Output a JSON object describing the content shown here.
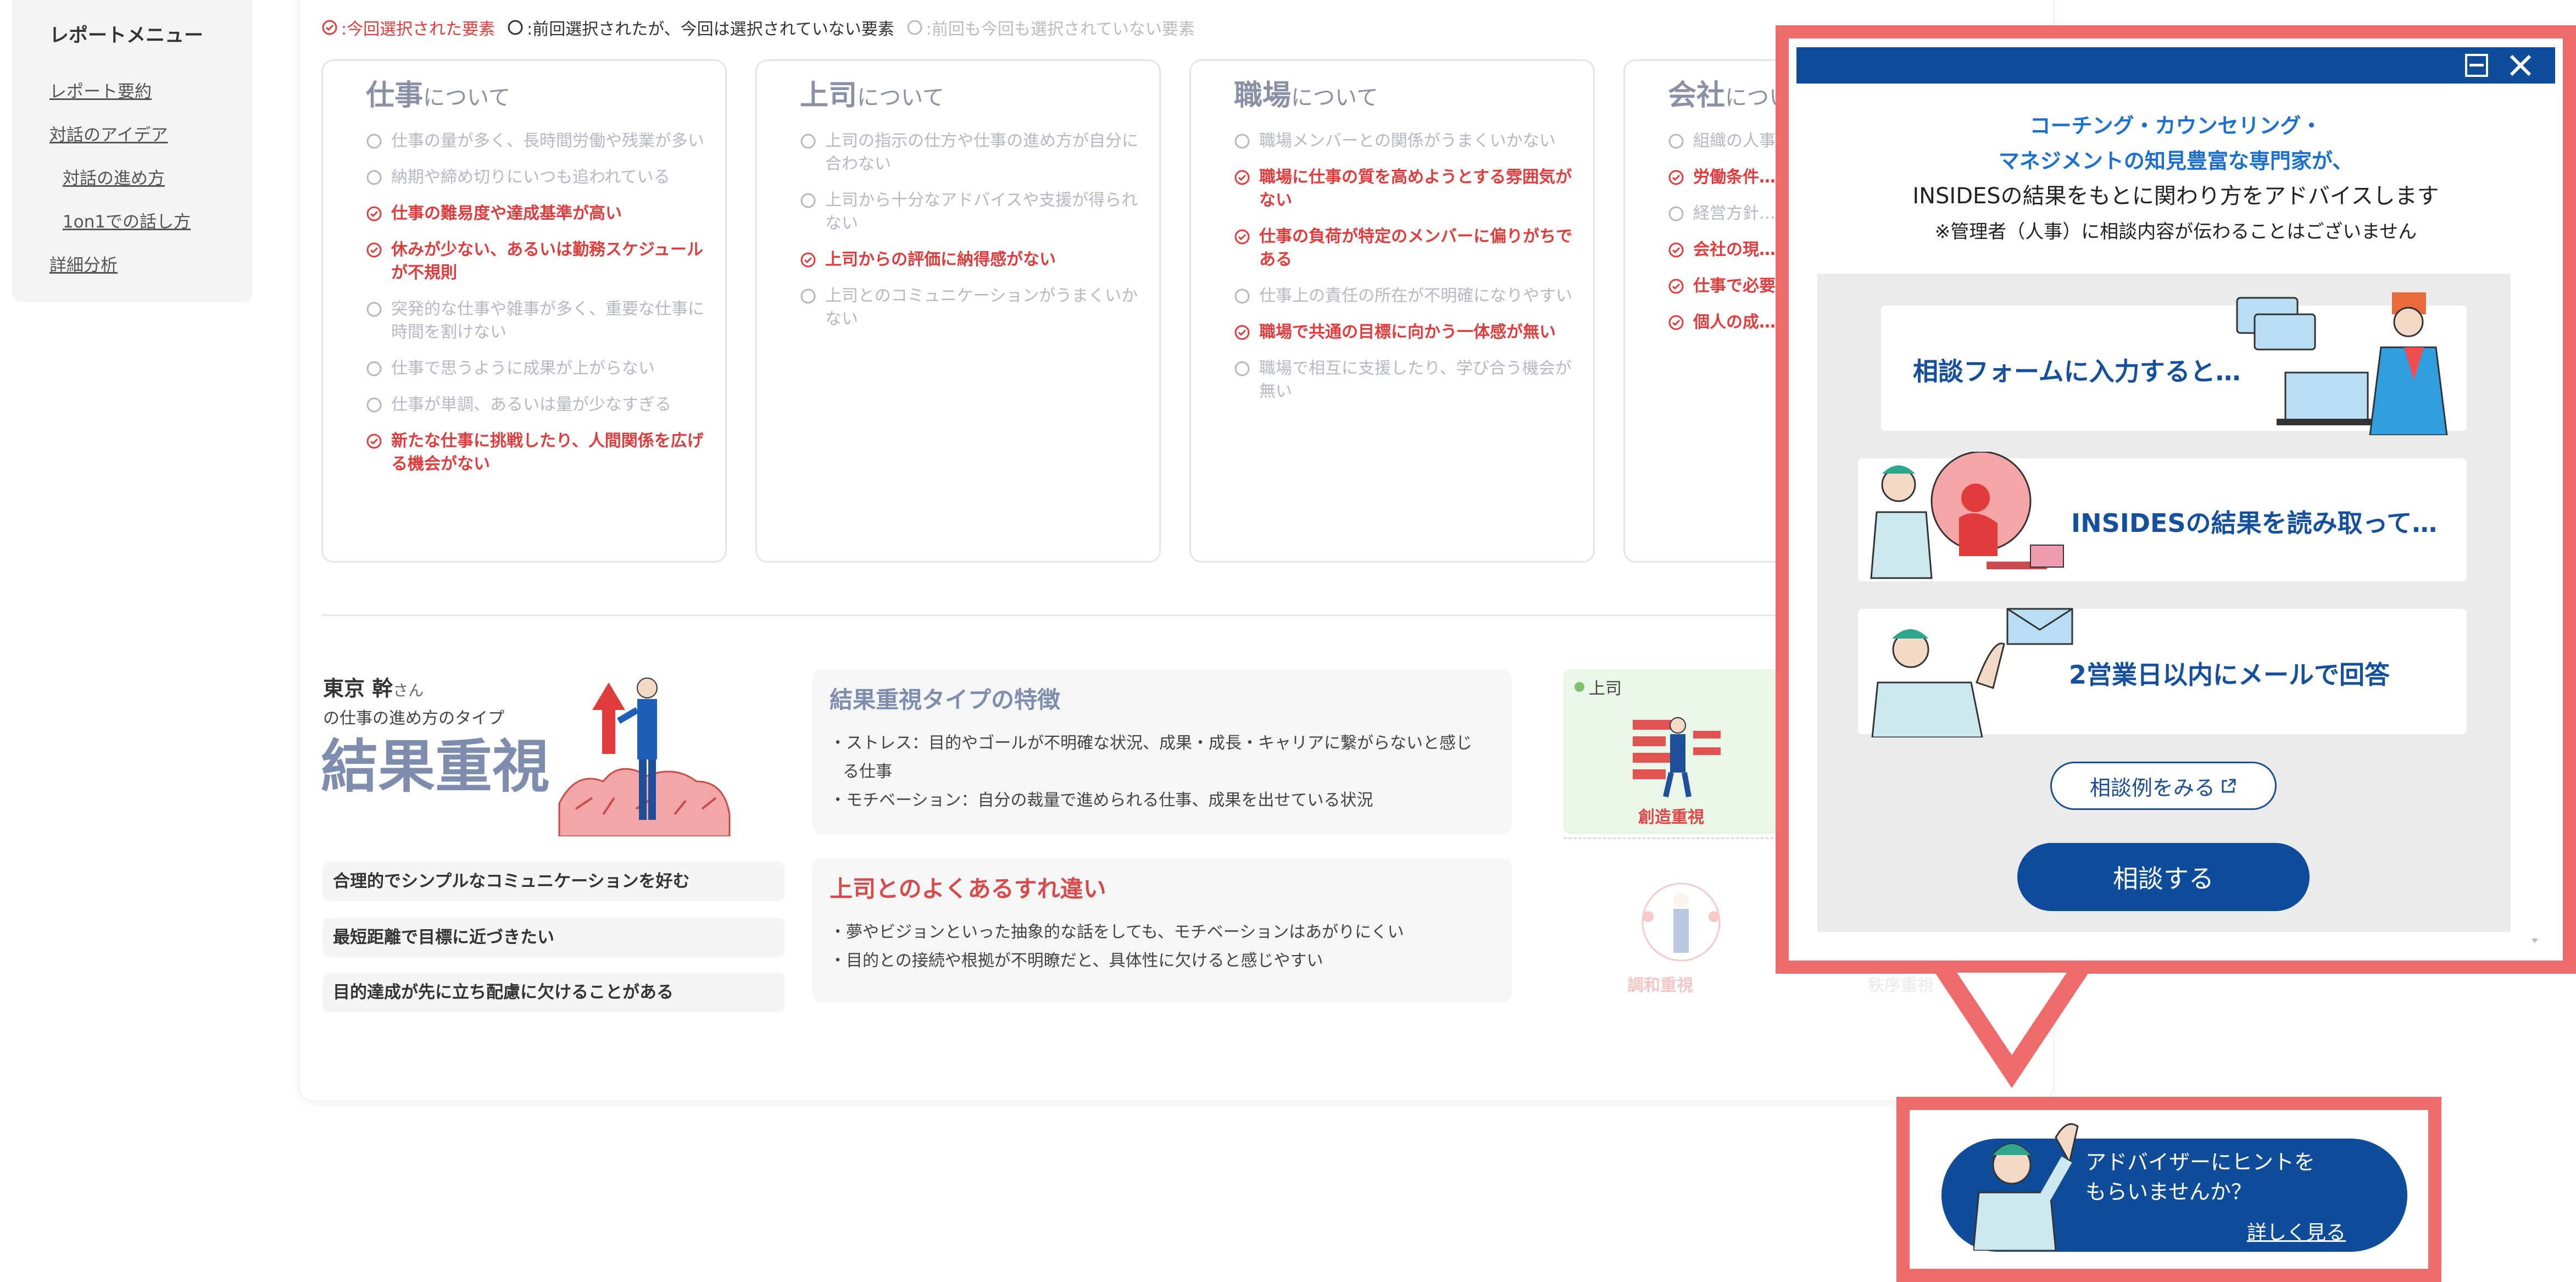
{
  "sidebar": {
    "title": "レポートメニュー",
    "items": [
      {
        "label": "レポート要約",
        "sub": false
      },
      {
        "label": "対話のアイデア",
        "sub": false
      },
      {
        "label": "対話の進め方",
        "sub": true
      },
      {
        "label": "1on1での話し方",
        "sub": true
      },
      {
        "label": "詳細分析",
        "sub": false
      }
    ]
  },
  "legend": {
    "selected": ":今回選択された要素",
    "previous": ":前回選択されたが、今回は選択されていない要素",
    "none": ":前回も今回も選択されていない要素"
  },
  "columns": [
    {
      "title": "仕事",
      "suffix": "について",
      "items": [
        {
          "text": "仕事の量が多く、長時間労働や残業が多い",
          "status": "none"
        },
        {
          "text": "納期や締め切りにいつも追われている",
          "status": "none"
        },
        {
          "text": "仕事の難易度や達成基準が高い",
          "status": "sel"
        },
        {
          "text": "休みが少ない、あるいは勤務スケジュールが不規則",
          "status": "sel"
        },
        {
          "text": "突発的な仕事や雑事が多く、重要な仕事に時間を割けない",
          "status": "none"
        },
        {
          "text": "仕事で思うように成果が上がらない",
          "status": "none"
        },
        {
          "text": "仕事が単調、あるいは量が少なすぎる",
          "status": "none"
        },
        {
          "text": "新たな仕事に挑戦したり、人間関係を広げる機会がない",
          "status": "sel"
        }
      ]
    },
    {
      "title": "上司",
      "suffix": "について",
      "items": [
        {
          "text": "上司の指示の仕方や仕事の進め方が自分に合わない",
          "status": "none"
        },
        {
          "text": "上司から十分なアドバイスや支援が得られない",
          "status": "none"
        },
        {
          "text": "上司からの評価に納得感がない",
          "status": "sel"
        },
        {
          "text": "上司とのコミュニケーションがうまくいかない",
          "status": "none"
        }
      ]
    },
    {
      "title": "職場",
      "suffix": "について",
      "items": [
        {
          "text": "職場メンバーとの関係がうまくいかない",
          "status": "none"
        },
        {
          "text": "職場に仕事の質を高めようとする雰囲気がない",
          "status": "sel"
        },
        {
          "text": "仕事の負荷が特定のメンバーに偏りがちである",
          "status": "sel"
        },
        {
          "text": "仕事上の責任の所在が不明確になりやすい",
          "status": "none"
        },
        {
          "text": "職場で共通の目標に向かう一体感が無い",
          "status": "sel"
        },
        {
          "text": "職場で相互に支援したり、学び合う機会が無い",
          "status": "none"
        }
      ]
    },
    {
      "title": "会社",
      "suffix": "について",
      "items": [
        {
          "text": "組織の人事…る",
          "status": "none"
        },
        {
          "text": "労働条件…",
          "status": "sel"
        },
        {
          "text": "経営方針…",
          "status": "none"
        },
        {
          "text": "会社の現…",
          "status": "sel"
        },
        {
          "text": "仕事で必要…けるための…ない",
          "status": "sel"
        },
        {
          "text": "個人の成…配置や異…",
          "status": "sel"
        }
      ]
    }
  ],
  "type": {
    "name": "東京 幹",
    "name_suffix": "さん",
    "subtitle": "の仕事の進め方のタイプ",
    "type_name": "結果重視",
    "traits": [
      "合理的でシンプルなコミュニケーションを好む",
      "最短距離で目標に近づきたい",
      "目的達成が先に立ち配慮に欠けることがある"
    ],
    "features": {
      "title": "結果重視タイプの特徴",
      "lines": [
        "・ストレス：目的やゴールが不明確な状況、成果・成長・キャリアに繋がらないと感じ",
        "る仕事",
        "・モチベーション：自分の裁量で進められる仕事、成果を出せている状況"
      ]
    },
    "gaps": {
      "title": "上司とのよくあるすれ違い",
      "lines": [
        "・夢やビジョンといった抽象的な話をしても、モチベーションはあがりにくい",
        "・目的との接続や根拠が不明瞭だと、具体性に欠けると感じやすい"
      ]
    },
    "boss_label": "上司",
    "boss_type": "創造重視",
    "faded_type_1": "調和重視",
    "faded_type_2": "秩序重視"
  },
  "popup": {
    "line1": "コーチング・カウンセリング・",
    "line2": "マネジメントの知見豊富な専門家が、",
    "line3": "INSIDESの結果をもとに関わり方をアドバイスします",
    "line4": "※管理者（人事）に相談内容が伝わることはございません",
    "steps": [
      "相談フォームに入力すると…",
      "INSIDESの結果を読み取って…",
      "2営業日以内にメールで回答"
    ],
    "examples_label": "相談例をみる",
    "consult_label": "相談する"
  },
  "banner": {
    "line1": "アドバイザーにヒントを",
    "line2": "もらいませんか？",
    "link": "詳しく見る"
  },
  "colors": {
    "selected": "#e23b3b",
    "navy": "#0f4d9a",
    "frame": "#ef6b6b"
  }
}
